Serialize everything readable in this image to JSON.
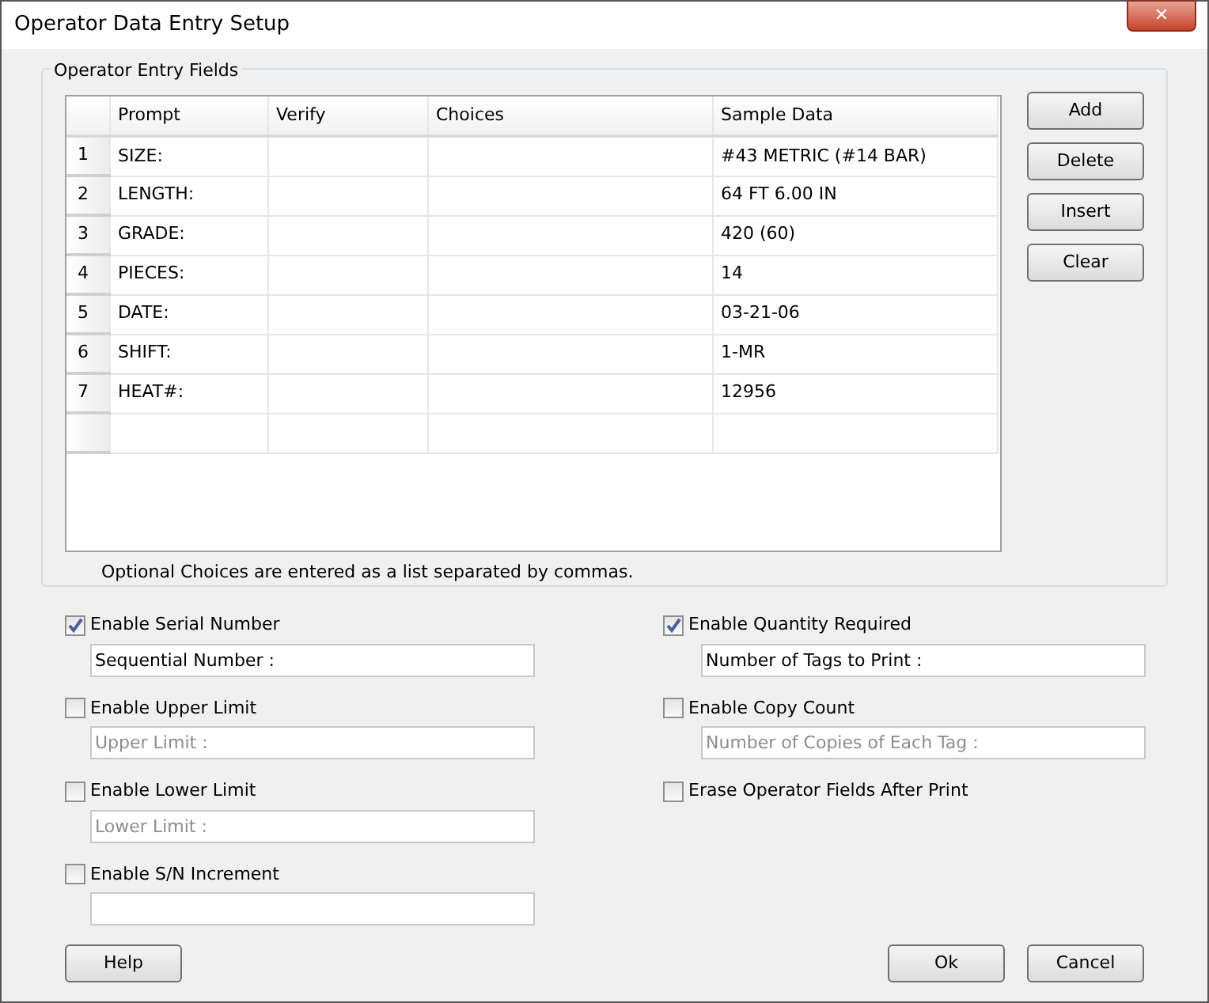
{
  "window": {
    "title": "Operator Data Entry Setup",
    "close": "✕"
  },
  "group": {
    "title": "Operator Entry Fields"
  },
  "table": {
    "columns": [
      "Prompt",
      "Verify",
      "Choices",
      "Sample Data"
    ],
    "rows": [
      {
        "number": "1",
        "cells": [
          "SIZE:",
          "",
          "",
          "#43 METRIC (#14 BAR)"
        ]
      },
      {
        "number": "2",
        "cells": [
          "LENGTH:",
          "",
          "",
          "64 FT 6.00 IN"
        ]
      },
      {
        "number": "3",
        "cells": [
          "GRADE:",
          "",
          "",
          "420 (60)"
        ]
      },
      {
        "number": "4",
        "cells": [
          "PIECES:",
          "",
          "",
          "14"
        ]
      },
      {
        "number": "5",
        "cells": [
          "DATE:",
          "",
          "",
          "03-21-06"
        ]
      },
      {
        "number": "6",
        "cells": [
          "SHIFT:",
          "",
          "",
          "1-MR"
        ]
      },
      {
        "number": "7",
        "cells": [
          "HEAT#:",
          "",
          "",
          "12956"
        ]
      },
      {
        "number": "",
        "cells": [
          "",
          "",
          "",
          ""
        ]
      }
    ]
  },
  "side_buttons": [
    "Add",
    "Delete",
    "Insert",
    "Clear"
  ],
  "note": "Optional Choices are entered as a list separated by commas.",
  "left_options": [
    {
      "label": "Enable Serial Number",
      "checked": true,
      "field": {
        "value": "Sequential Number :"
      }
    },
    {
      "label": "Enable Upper Limit",
      "checked": false,
      "field": {
        "placeholder": "Upper Limit :"
      }
    },
    {
      "label": "Enable Lower Limit",
      "checked": false,
      "field": {
        "placeholder": "Lower Limit :"
      }
    },
    {
      "label": "Enable S/N Increment",
      "checked": false,
      "kind": "field"
    }
  ],
  "right_options": [
    {
      "label": "Enable Quantity Required",
      "checked": true,
      "field": {
        "value": "Number of Tags to Print :"
      }
    },
    {
      "label": "Enable Copy Count",
      "checked": false,
      "field": {
        "placeholder": "Number of Copies of Each Tag :"
      }
    },
    {
      "label": "Erase Operator Fields After Print",
      "checked": false
    }
  ],
  "footer": {
    "help": "Help",
    "ok": "Ok",
    "cancel": "Cancel"
  }
}
